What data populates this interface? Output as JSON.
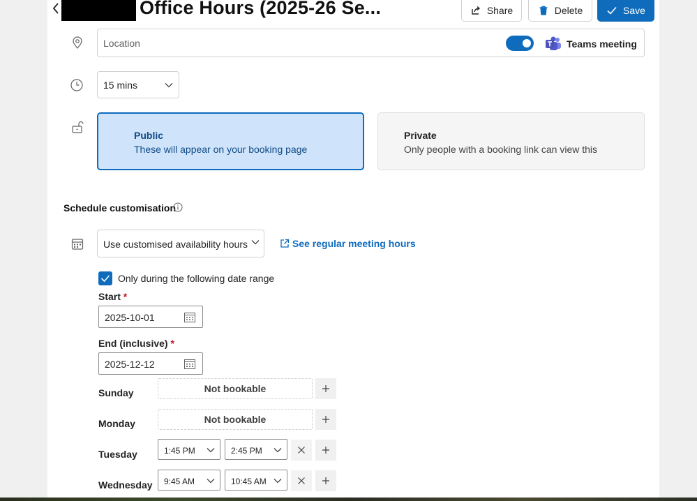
{
  "header": {
    "title": "Office Hours (2025-26 Se...",
    "share_label": "Share",
    "delete_label": "Delete",
    "save_label": "Save"
  },
  "location": {
    "placeholder": "Location",
    "teams_label": "Teams meeting",
    "teams_enabled": true
  },
  "duration": {
    "value": "15 mins"
  },
  "visibility": {
    "public": {
      "title": "Public",
      "description": "These will appear on your booking page",
      "selected": true
    },
    "private": {
      "title": "Private",
      "description": "Only people with a booking link can view this",
      "selected": false
    }
  },
  "schedule": {
    "title": "Schedule customisation",
    "availability_value": "Use customised availability hours",
    "see_hours_link": "See regular meeting hours",
    "date_range_label": "Only during the following date range",
    "date_range_checked": true,
    "start_label": "Start",
    "start_value": "2025-10-01",
    "end_label": "End (inclusive)",
    "end_value": "2025-12-12",
    "required_mark": "*",
    "days": [
      {
        "name": "Sunday",
        "status": "Not bookable"
      },
      {
        "name": "Monday",
        "status": "Not bookable"
      },
      {
        "name": "Tuesday",
        "from": "1:45 PM",
        "to": "2:45 PM"
      },
      {
        "name": "Wednesday",
        "from": "9:45 AM",
        "to": "10:45 AM"
      }
    ]
  },
  "colors": {
    "accent": "#0f6cbd",
    "selected_card_bg": "#cfe4fa",
    "required": "#c50f1f"
  },
  "icons": [
    "chevron-left-icon",
    "share-icon",
    "trash-icon",
    "checkmark-icon",
    "location-pin-icon",
    "teams-icon",
    "clock-icon",
    "unlock-icon",
    "info-icon",
    "calendar-grid-icon",
    "open-external-icon",
    "calendar-icon",
    "plus-icon",
    "close-icon",
    "chevron-down-icon"
  ]
}
